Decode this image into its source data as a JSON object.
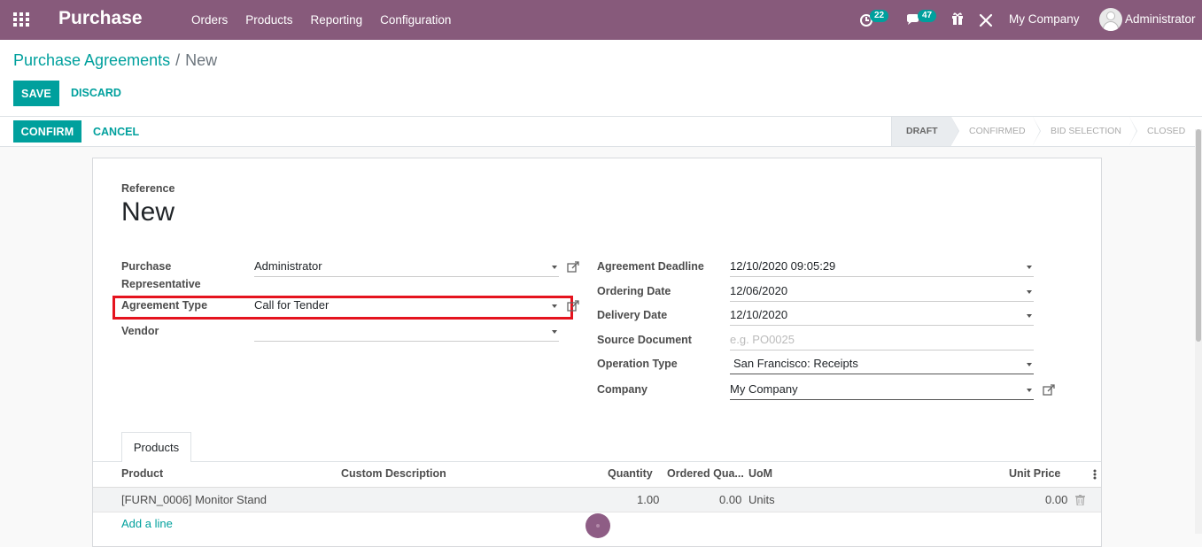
{
  "navbar": {
    "app_title": "Purchase",
    "menu": [
      "Orders",
      "Products",
      "Reporting",
      "Configuration"
    ],
    "activity_count": "22",
    "messages_count": "47",
    "company": "My Company",
    "user": "Administrator"
  },
  "breadcrumb": {
    "parent": "Purchase Agreements",
    "separator": "/",
    "current": "New"
  },
  "actions": {
    "save": "SAVE",
    "discard": "DISCARD",
    "confirm": "CONFIRM",
    "cancel": "CANCEL"
  },
  "status_bar": {
    "stages": [
      "DRAFT",
      "CONFIRMED",
      "BID SELECTION",
      "CLOSED"
    ],
    "active": "DRAFT"
  },
  "form": {
    "reference_label": "Reference",
    "reference_value": "New",
    "left": {
      "purchase_rep_label_1": "Purchase",
      "purchase_rep_label_2": "Representative",
      "purchase_rep_value": "Administrator",
      "agreement_type_label": "Agreement Type",
      "agreement_type_value": "Call for Tender",
      "vendor_label": "Vendor",
      "vendor_value": ""
    },
    "right": {
      "deadline_label": "Agreement Deadline",
      "deadline_value": "12/10/2020 09:05:29",
      "ordering_date_label": "Ordering Date",
      "ordering_date_value": "12/06/2020",
      "delivery_date_label": "Delivery Date",
      "delivery_date_value": "12/10/2020",
      "source_doc_label": "Source Document",
      "source_doc_placeholder": "e.g. PO0025",
      "operation_type_label": "Operation Type",
      "operation_type_value": "San Francisco: Receipts",
      "company_label": "Company",
      "company_value": "My Company"
    }
  },
  "products_tab": {
    "tab_label": "Products",
    "columns": [
      "Product",
      "Custom Description",
      "Quantity",
      "Ordered Qua...",
      "UoM",
      "Unit Price"
    ],
    "rows": [
      {
        "product": "[FURN_0006] Monitor Stand",
        "description": "",
        "quantity": "1.00",
        "ordered_qty": "0.00",
        "uom": "Units",
        "unit_price": "0.00"
      }
    ],
    "add_line": "Add a line"
  }
}
